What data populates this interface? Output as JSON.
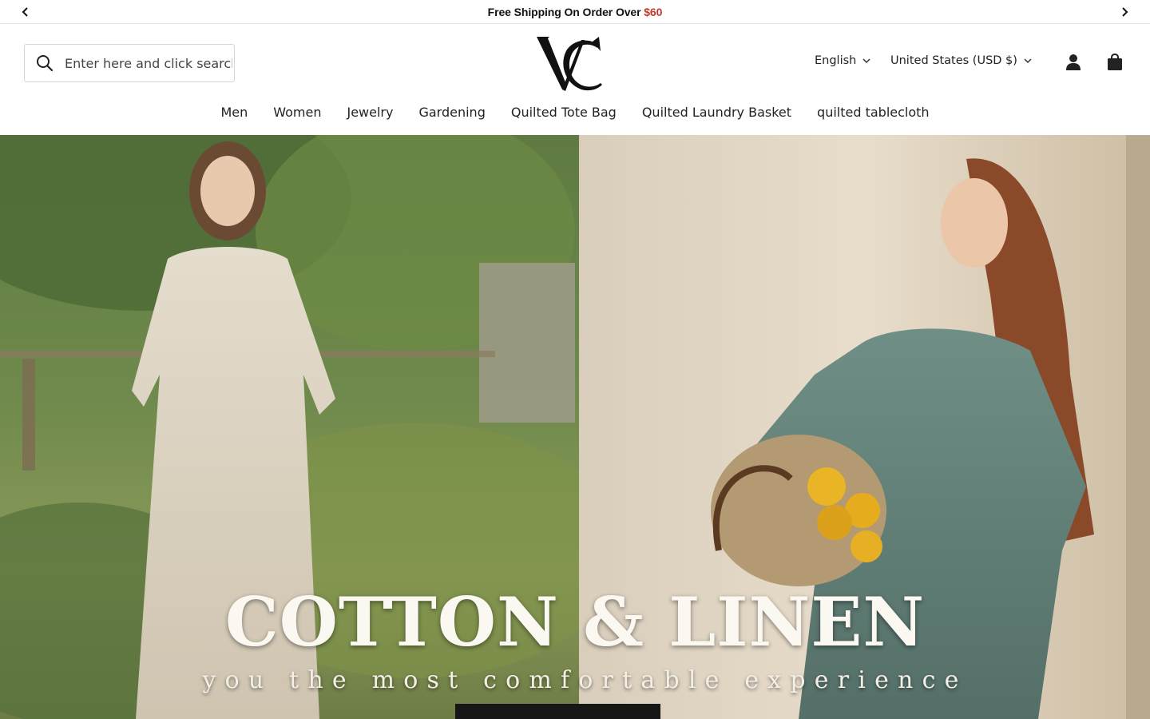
{
  "announcement": {
    "prev_label": "Previous",
    "next_label": "Next",
    "glyph": "",
    "text": "Free Shipping On Order Over ",
    "amount": "$60"
  },
  "header": {
    "search": {
      "placeholder": "Enter here and click search"
    },
    "logo": "VC",
    "language": "English",
    "currency": "United States (USD $)"
  },
  "nav": {
    "items": [
      {
        "label": "Men"
      },
      {
        "label": "Women"
      },
      {
        "label": "Jewelry"
      },
      {
        "label": "Gardening"
      },
      {
        "label": "Quilted Tote Bag"
      },
      {
        "label": "Quilted Laundry Basket"
      },
      {
        "label": "quilted tablecloth"
      }
    ]
  },
  "hero": {
    "headline": "COTTON & LINEN",
    "tagline": "you the most comfortable experience",
    "cta_label": ""
  },
  "colors": {
    "accent_price": "#c0392b",
    "cta_bg": "#161616"
  }
}
